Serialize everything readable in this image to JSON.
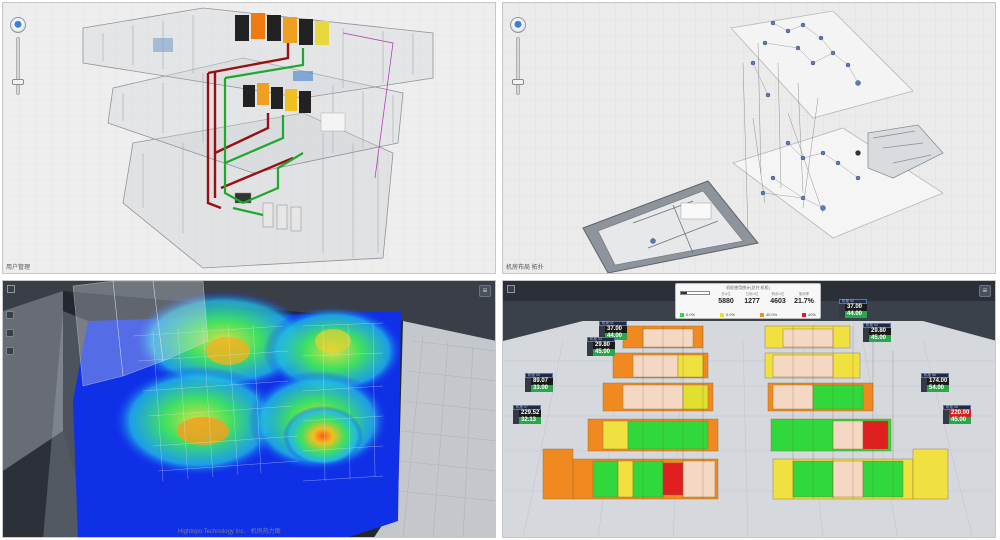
{
  "panels": {
    "building_pipes": {
      "caption": "用户管理"
    },
    "network_topology": {
      "caption": "机房布局 拓扑"
    },
    "thermal_map": {
      "watermark": "Hightopo Technology Inc. · 机房热力图"
    },
    "rack_capacity": {
      "stats": {
        "title": "机柜使用统计(总共 机柜)",
        "labels": [
          "总U位",
          "已用U位",
          "剩余U位",
          "使用率"
        ],
        "values": [
          "5880",
          "1277",
          "4603",
          "21.7%"
        ],
        "usage_fraction": 0.217,
        "legend": [
          {
            "label": "空闲",
            "value": "0.0%",
            "color": "#2fd84a"
          },
          {
            "label": "20%",
            "value": "0.0%",
            "color": "#f0e020"
          },
          {
            "label": "40%",
            "value": "40.0%",
            "color": "#f09020"
          },
          {
            "label": "80%",
            "value": "40%",
            "color": "#e02020"
          }
        ]
      },
      "tags": [
        {
          "title": "机柜 01",
          "v1": "37.00",
          "v2": "44.00",
          "hot": false
        },
        {
          "title": "机柜 02",
          "v1": "37.00",
          "v2": "44.00",
          "hot": false
        },
        {
          "title": "机柜 03",
          "v1": "29.80",
          "v2": "45.00",
          "hot": false
        },
        {
          "title": "机柜 04",
          "v1": "29.80",
          "v2": "45.00",
          "hot": false
        },
        {
          "title": "机柜 05",
          "v1": "89.07",
          "v2": "33.00",
          "hot": false
        },
        {
          "title": "机柜 06",
          "v1": "174.00",
          "v2": "54.00",
          "hot": false
        },
        {
          "title": "机柜 07",
          "v1": "229.52",
          "v2": "32.13",
          "hot": false
        },
        {
          "title": "机柜 08",
          "v1": "220.00",
          "v2": "45.00",
          "hot": true
        }
      ]
    }
  },
  "colors": {
    "pipe_red": "#9a1010",
    "pipe_green": "#1ea82e",
    "rack_dark": "#222222",
    "rack_orange": "#f07a10",
    "thermal_cold": "#1030e8",
    "thermal_hot": "#ff5a10"
  }
}
